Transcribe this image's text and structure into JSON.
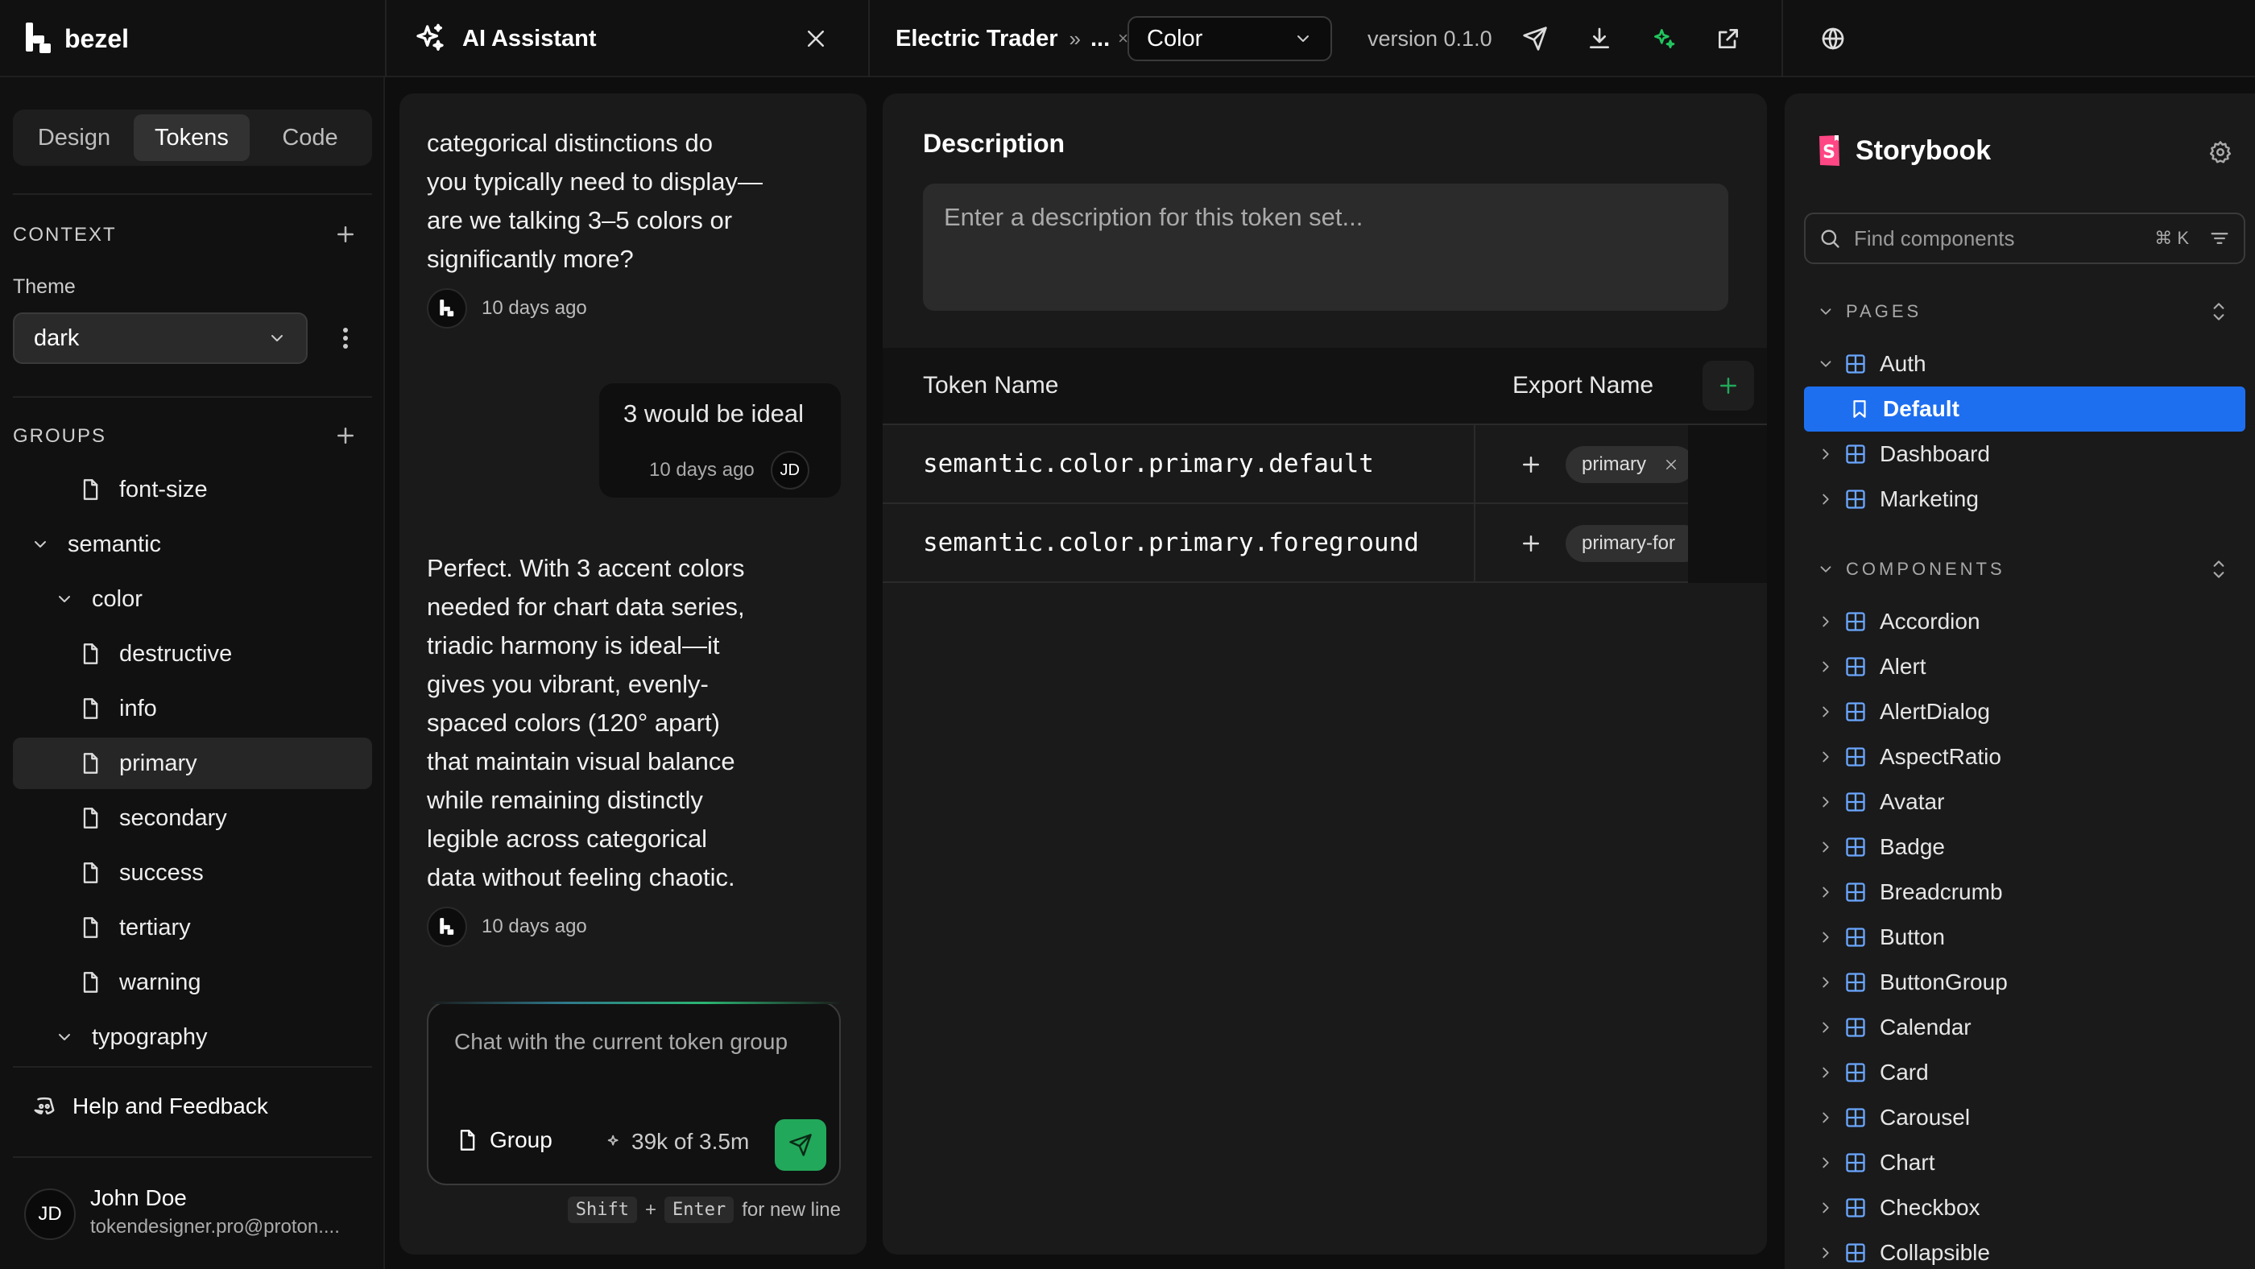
{
  "app": {
    "name": "bezel"
  },
  "assistant": {
    "title": "AI Assistant"
  },
  "breadcrumb": {
    "project": "Electric Trader",
    "sep": "»",
    "ellipsis": "...",
    "x": "×",
    "group": "Color"
  },
  "version": "version 0.1.0",
  "tabs": [
    "Design",
    "Tokens",
    "Code"
  ],
  "context": {
    "title": "CONTEXT",
    "theme_label": "Theme",
    "theme_value": "dark"
  },
  "groups": {
    "title": "GROUPS",
    "items": [
      {
        "label": "font-size",
        "kind": "file"
      },
      {
        "label": "semantic",
        "kind": "folder"
      },
      {
        "label": "color",
        "kind": "folder"
      },
      {
        "label": "destructive",
        "kind": "file"
      },
      {
        "label": "info",
        "kind": "file"
      },
      {
        "label": "primary",
        "kind": "file"
      },
      {
        "label": "secondary",
        "kind": "file"
      },
      {
        "label": "success",
        "kind": "file"
      },
      {
        "label": "tertiary",
        "kind": "file"
      },
      {
        "label": "warning",
        "kind": "file"
      },
      {
        "label": "typography",
        "kind": "folder"
      }
    ]
  },
  "help": "Help and Feedback",
  "user": {
    "initials": "JD",
    "name": "John Doe",
    "email": "tokendesigner.pro@proton...."
  },
  "chat": {
    "msg1": [
      "categorical distinctions do",
      "you typically need to display—",
      "are we talking 3–5 colors or",
      "significantly more?"
    ],
    "msg1_time": "10 days ago",
    "user_msg": "3 would be ideal",
    "user_time": "10 days ago",
    "msg2": [
      "Perfect. With 3 accent colors",
      "needed for chart data series,",
      "triadic harmony is ideal—it",
      "gives you vibrant, evenly-",
      "spaced colors (120° apart)",
      "that maintain visual balance",
      "while remaining distinctly",
      "legible across categorical",
      "data without feeling chaotic."
    ],
    "msg2_time": "10 days ago",
    "placeholder": "Chat with the current token group",
    "group_btn": "Group",
    "usage": "39k of 3.5m",
    "hint_shift": "Shift",
    "hint_plus": "+",
    "hint_enter": "Enter",
    "hint_text": "for new line"
  },
  "description": {
    "title": "Description",
    "placeholder": "Enter a description for this token set..."
  },
  "table": {
    "col_name": "Token Name",
    "col_export": "Export Name",
    "rows": [
      {
        "name": "semantic.color.primary.default",
        "export": "primary"
      },
      {
        "name": "semantic.color.primary.foreground",
        "export": "primary-for"
      }
    ]
  },
  "storybook": {
    "title": "Storybook",
    "search_placeholder": "Find components",
    "shortcut": "⌘ K",
    "pages_title": "PAGES",
    "pages": [
      "Auth",
      "Default",
      "Dashboard",
      "Marketing"
    ],
    "components_title": "COMPONENTS",
    "components": [
      "Accordion",
      "Alert",
      "AlertDialog",
      "AspectRatio",
      "Avatar",
      "Badge",
      "Breadcrumb",
      "Button",
      "ButtonGroup",
      "Calendar",
      "Card",
      "Carousel",
      "Chart",
      "Checkbox",
      "Collapsible"
    ]
  },
  "colors": {
    "accent_green": "#22a85a",
    "selection_blue": "#1e6ff0",
    "storybook_pink": "#ff4785"
  }
}
